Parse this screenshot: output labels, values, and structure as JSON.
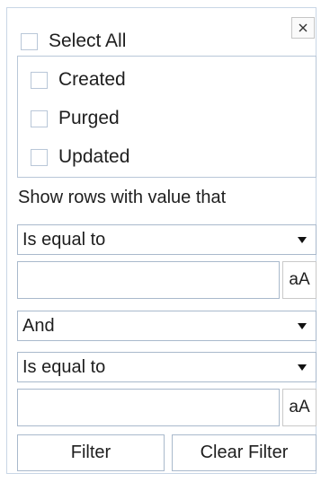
{
  "select_all": {
    "label": "Select All",
    "checked": false
  },
  "close_button": {
    "icon": "close-icon",
    "glyph": "✕"
  },
  "values": [
    {
      "label": "Created",
      "checked": false
    },
    {
      "label": "Purged",
      "checked": false
    },
    {
      "label": "Updated",
      "checked": false
    }
  ],
  "condition_caption": "Show rows with value that",
  "condition1": {
    "operator": "Is equal to",
    "value": "",
    "case_label": "aA"
  },
  "logic": {
    "operator": "And"
  },
  "condition2": {
    "operator": "Is equal to",
    "value": "",
    "case_label": "aA"
  },
  "buttons": {
    "filter": "Filter",
    "clear": "Clear Filter"
  },
  "colors": {
    "border": "#a9b9cc",
    "checkbox_border": "#b9c7d8"
  }
}
